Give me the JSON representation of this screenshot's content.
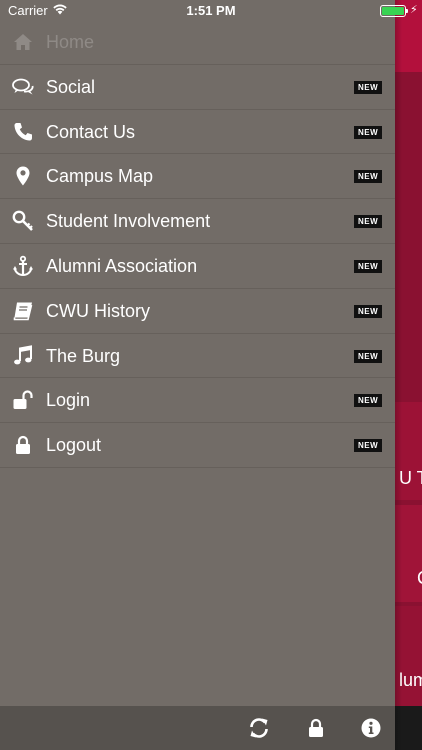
{
  "status_bar": {
    "carrier": "Carrier",
    "time": "1:51 PM"
  },
  "menu": {
    "items": [
      {
        "label": "Home",
        "icon": "home-icon",
        "badge": ""
      },
      {
        "label": "Social",
        "icon": "chat-bubbles-icon",
        "badge": "NEW"
      },
      {
        "label": "Contact Us",
        "icon": "phone-icon",
        "badge": "NEW"
      },
      {
        "label": "Campus Map",
        "icon": "map-pin-icon",
        "badge": "NEW"
      },
      {
        "label": "Student Involvement",
        "icon": "key-icon",
        "badge": "NEW"
      },
      {
        "label": "Alumni Association",
        "icon": "anchor-icon",
        "badge": "NEW"
      },
      {
        "label": "CWU History",
        "icon": "book-icon",
        "badge": "NEW"
      },
      {
        "label": "The Burg",
        "icon": "music-note-icon",
        "badge": "NEW"
      },
      {
        "label": "Login",
        "icon": "unlock-icon",
        "badge": "NEW"
      },
      {
        "label": "Logout",
        "icon": "lock-icon",
        "badge": "NEW"
      }
    ]
  },
  "background": {
    "partial_texts": [
      "U T",
      "C",
      "lum"
    ]
  },
  "toolbar": {
    "icons": [
      "refresh-icon",
      "lock-icon",
      "info-icon"
    ]
  },
  "colors": {
    "drawer": "#726c67",
    "accent": "#b3103c",
    "toolbar": "#56524e"
  }
}
